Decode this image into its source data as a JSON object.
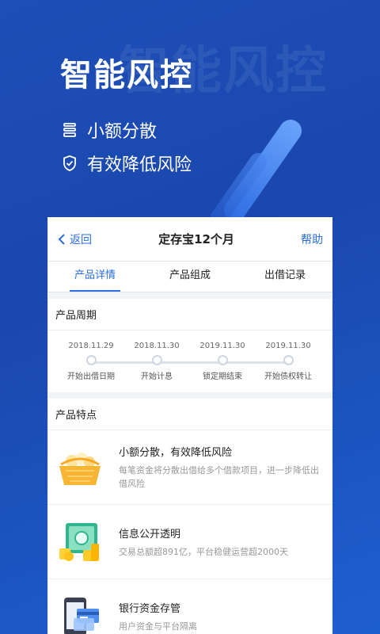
{
  "hero": {
    "watermark": "智能风控",
    "title": "智能风控",
    "features": [
      {
        "icon": "coin-stack-icon",
        "text": "小额分散"
      },
      {
        "icon": "shield-check-icon",
        "text": "有效降低风险"
      }
    ]
  },
  "nav": {
    "back_label": "返回",
    "title": "定存宝12个月",
    "help_label": "帮助"
  },
  "tabs": [
    {
      "label": "产品详情",
      "active": true
    },
    {
      "label": "产品组成",
      "active": false
    },
    {
      "label": "出借记录",
      "active": false
    }
  ],
  "cycle": {
    "title": "产品周期",
    "steps": [
      {
        "date": "2018.11.29",
        "label": "开始出借日期"
      },
      {
        "date": "2018.11.30",
        "label": "开始计息"
      },
      {
        "date": "2019.11.30",
        "label": "锁定期结束"
      },
      {
        "date": "2019.11.30",
        "label": "开始债权转让"
      }
    ]
  },
  "features_section": {
    "title": "产品特点",
    "items": [
      {
        "title": "小额分散，有效降低风险",
        "desc": "每笔资金将分散出借给多个借款项目，进一步降低出借风险",
        "icon": "basket-icon"
      },
      {
        "title": "信息公开透明",
        "desc": "交易总额超891亿，平台稳健运营超2000天",
        "icon": "safe-icon"
      },
      {
        "title": "银行资金存管",
        "desc": "用户资金与平台隔离",
        "icon": "bank-card-icon"
      }
    ]
  },
  "colors": {
    "accent": "#2a6ee0",
    "bg_top": "#1d4fb8"
  }
}
